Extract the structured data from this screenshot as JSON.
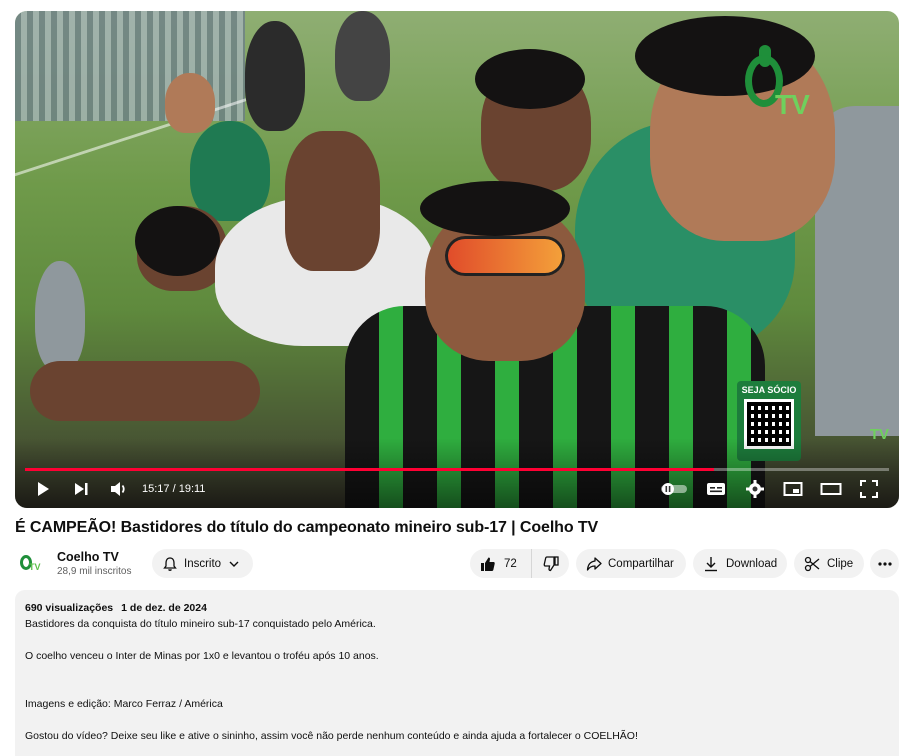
{
  "player": {
    "current_time": "15:17",
    "separator": " / ",
    "duration": "19:11",
    "progress_fraction": 0.797,
    "overlay": {
      "logo_text": "TV",
      "qr_label": "SEJA SÓCIO",
      "corner_watermark": "TV"
    },
    "controls": [
      "play-icon",
      "next-icon",
      "volume-icon",
      "autoplay-toggle",
      "subtitles-icon",
      "settings-icon",
      "miniplayer-icon",
      "theater-icon",
      "fullscreen-icon"
    ]
  },
  "video": {
    "title": "É CAMPEÃO! Bastidores do título do campeonato mineiro sub-17 | Coelho TV"
  },
  "channel": {
    "name": "Coelho TV",
    "subscribers": "28,9 mil inscritos",
    "avatar_text": "TV"
  },
  "actions": {
    "subscribe_label": "Inscrito",
    "like_count": "72",
    "share_label": "Compartilhar",
    "download_label": "Download",
    "clip_label": "Clipe"
  },
  "description": {
    "views": "690 visualizações",
    "date": "1 de dez. de 2024",
    "lines": [
      "Bastidores da conquista do título mineiro sub-17 conquistado pelo América.",
      "O coelho venceu o Inter de Minas por 1x0 e levantou o troféu após 10 anos.",
      "Imagens e edição: Marco Ferraz / América",
      "Gostou do vídeo? Deixe seu like e ative o sininho, assim você não perde nenhum conteúdo e ainda ajuda a fortalecer o COELHÃO!"
    ]
  },
  "colors": {
    "progress": "#ff0033",
    "brand_green": "#1f8f3a",
    "pill_bg": "#f2f2f2"
  }
}
